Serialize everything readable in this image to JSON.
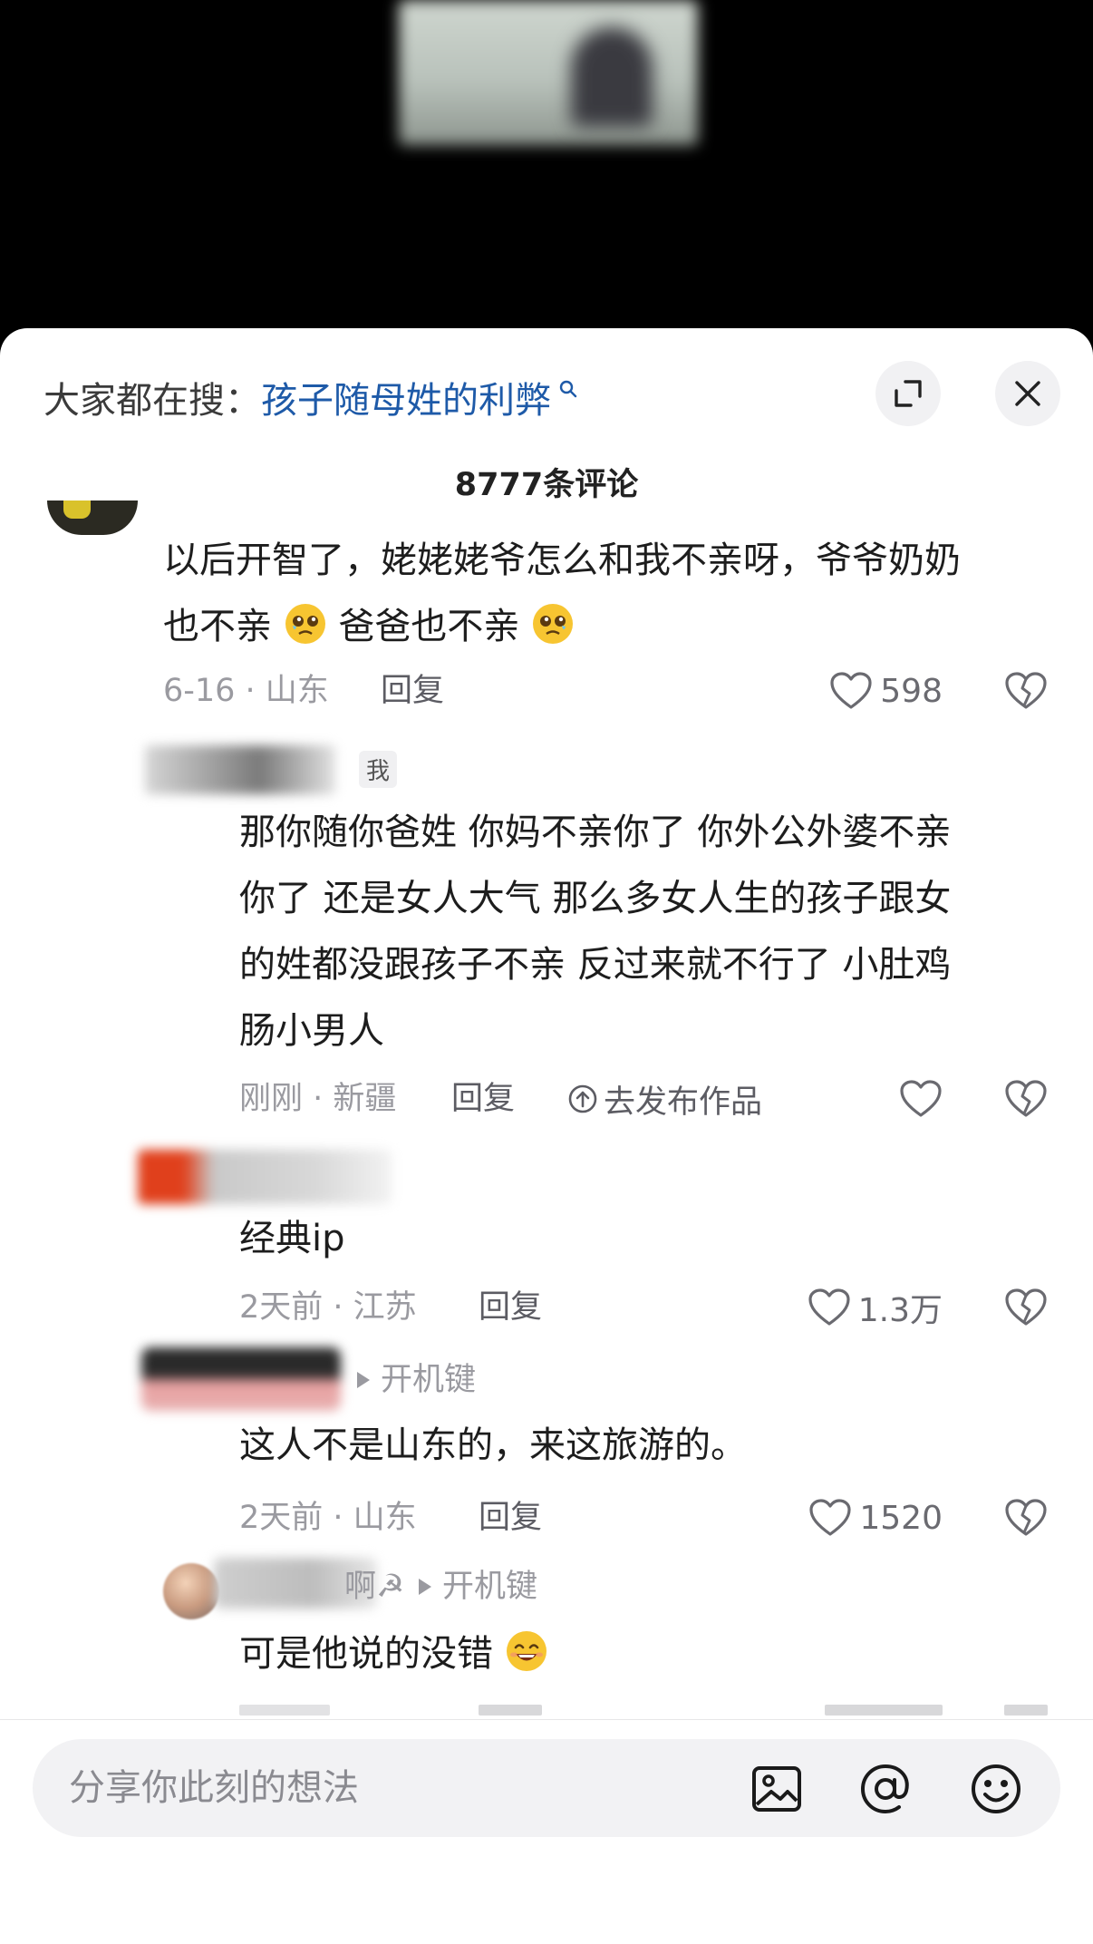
{
  "search": {
    "prefix": "大家都在搜：",
    "term": "孩子随母姓的利弊"
  },
  "comment_count": "8777条评论",
  "comments": [
    {
      "text_line1": "以后开智了，姥姥姥爷怎么和我不亲呀，爷爷奶奶",
      "text_line2_a": "也不亲",
      "text_line2_b": "爸爸也不亲",
      "meta": "6-16 · 山东",
      "reply": "回复",
      "likes": "598"
    },
    {
      "badge": "我",
      "text_lines": [
        "那你随你爸姓 你妈不亲你了 你外公外婆不亲",
        "你了 还是女人大气 那么多女人生的孩子跟女",
        "的姓都没跟孩子不亲 反过来就不行了 小肚鸡",
        "肠小男人"
      ],
      "meta": "刚刚 · 新疆",
      "reply": "回复",
      "publish": "去发布作品"
    },
    {
      "text": "经典ip",
      "meta": "2天前 · 江苏",
      "reply": "回复",
      "likes": "1.3万"
    },
    {
      "reply_to": "开机键",
      "text": "这人不是山东的，来这旅游的。",
      "meta": "2天前 · 山东",
      "reply": "回复",
      "likes": "1520"
    },
    {
      "name_partial": "啊☭",
      "reply_to": "开机键",
      "text": "可是他说的没错"
    }
  ],
  "input": {
    "placeholder": "分享你此刻的想法"
  }
}
